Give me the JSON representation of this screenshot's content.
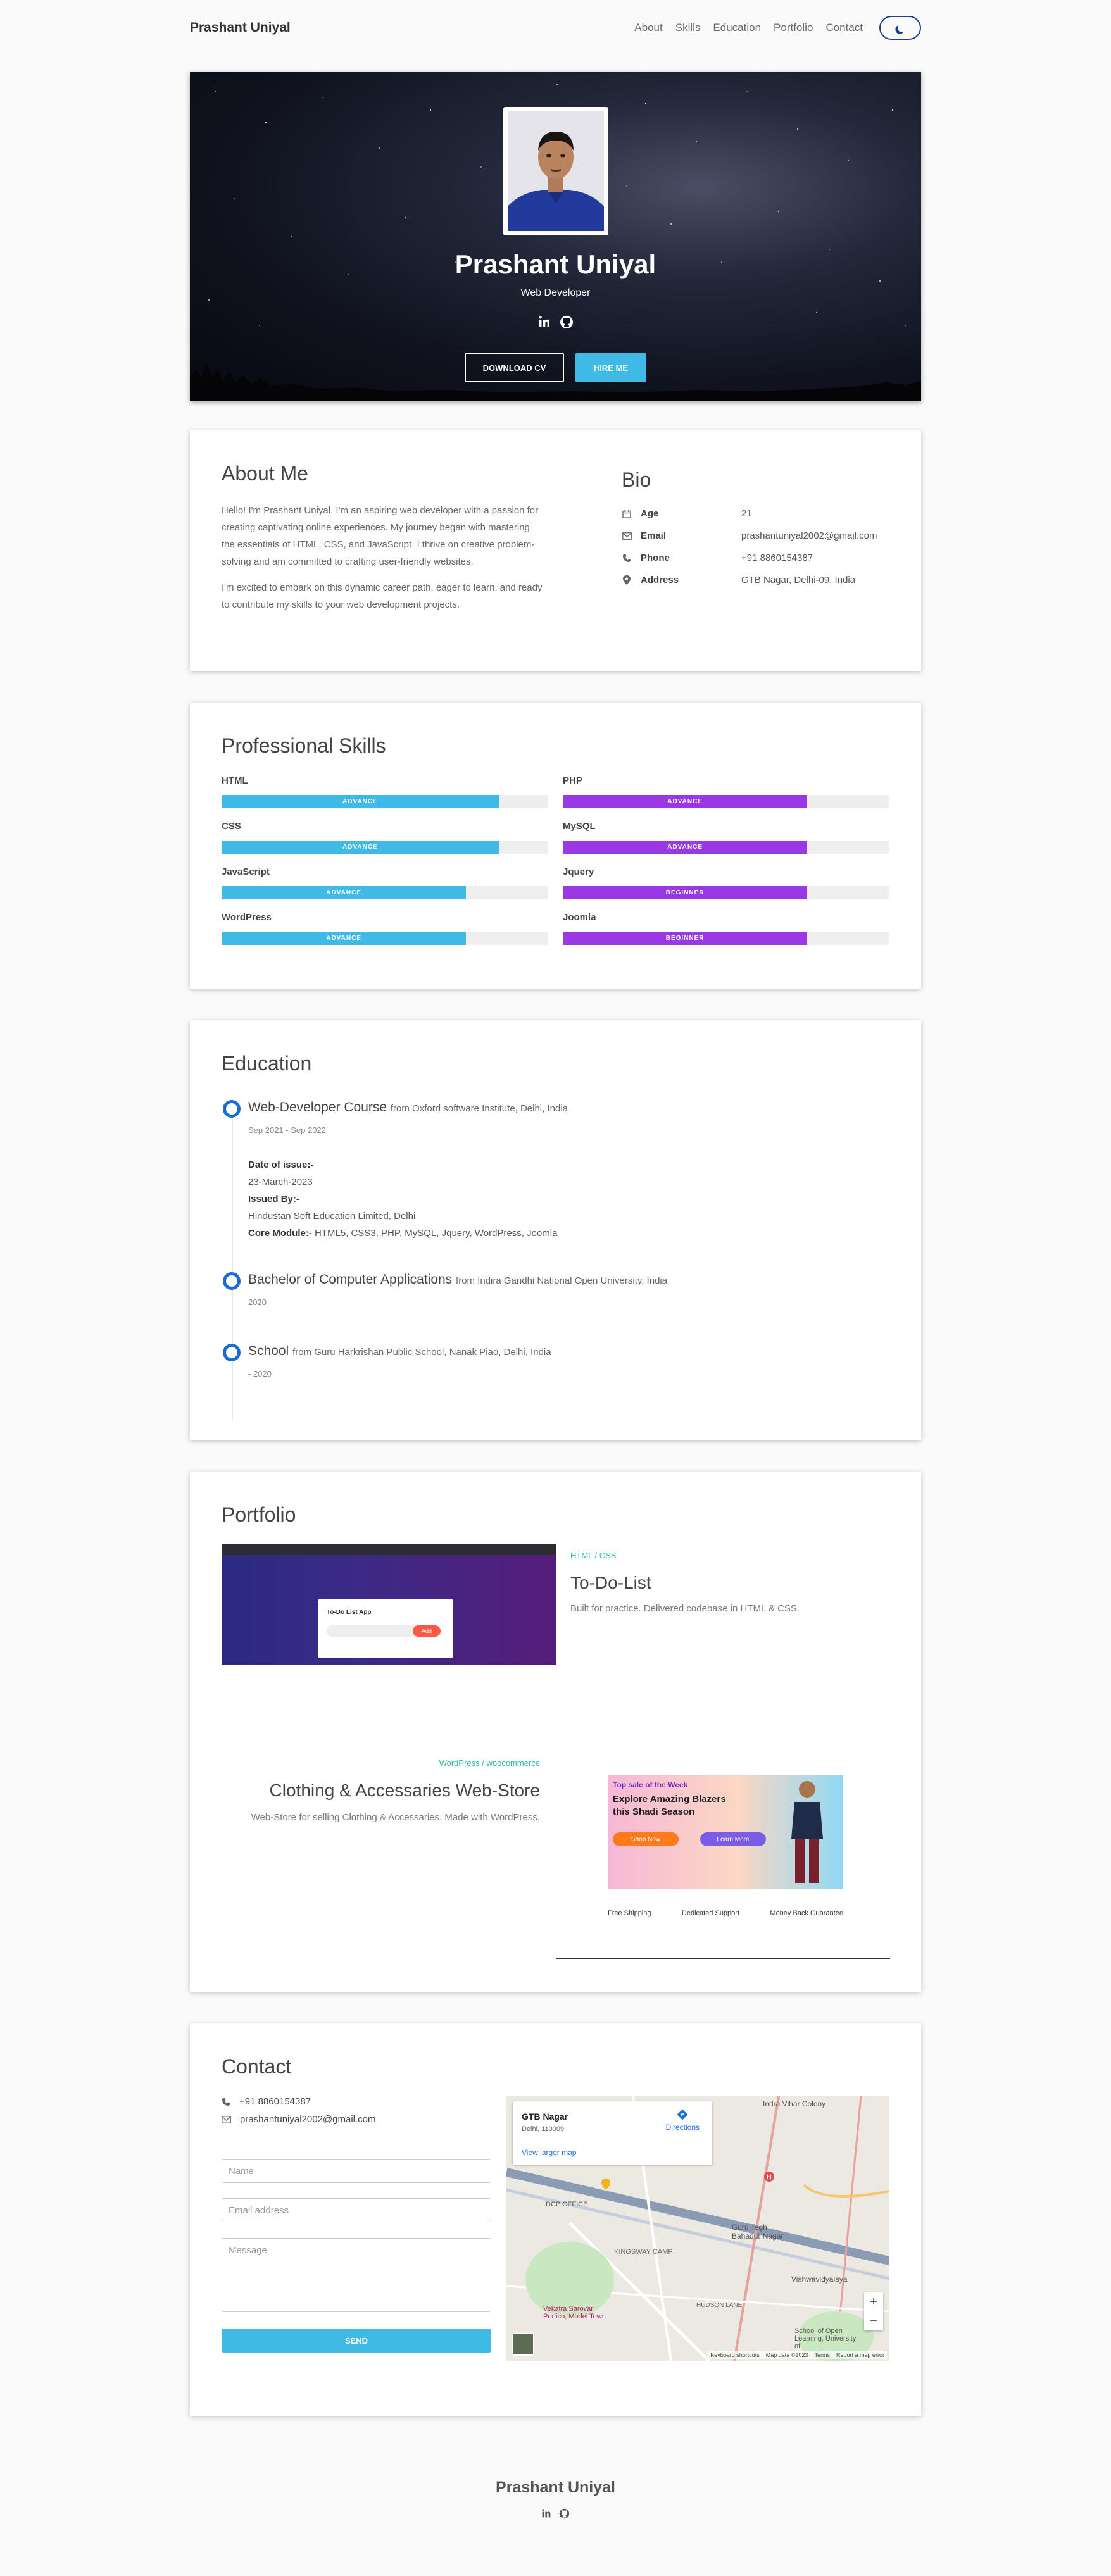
{
  "nav": {
    "brand": "Prashant Uniyal",
    "links": [
      "About",
      "Skills",
      "Education",
      "Portfolio",
      "Contact"
    ]
  },
  "hero": {
    "name": "Prashant Uniyal",
    "role": "Web Developer",
    "download_label": "DOWNLOAD CV",
    "hire_label": "HIRE ME",
    "social_icons": [
      "linkedin-icon",
      "github-icon"
    ]
  },
  "about": {
    "title": "About Me",
    "paragraphs": [
      "Hello! I'm Prashant Uniyal. I'm an aspiring web developer with a passion for creating captivating online experiences. My journey began with mastering the essentials of HTML, CSS, and JavaScript. I thrive on creative problem-solving and am committed to crafting user-friendly websites.",
      "I'm excited to embark on this dynamic career path, eager to learn, and ready to contribute my skills to your web development projects."
    ],
    "bio_title": "Bio",
    "bio": [
      {
        "icon": "calendar-icon",
        "key": "Age",
        "value": "21"
      },
      {
        "icon": "envelope-icon",
        "key": "Email",
        "value": "prashantuniyal2002@gmail.com"
      },
      {
        "icon": "phone-icon",
        "key": "Phone",
        "value": "+91 8860154387"
      },
      {
        "icon": "map-pin-icon",
        "key": "Address",
        "value": "GTB Nagar, Delhi-09, India"
      }
    ]
  },
  "skills": {
    "title": "Professional Skills",
    "left": [
      {
        "name": "HTML",
        "level": "ADVANCE",
        "percent": 85
      },
      {
        "name": "CSS",
        "level": "ADVANCE",
        "percent": 85
      },
      {
        "name": "JavaScript",
        "level": "ADVANCE",
        "percent": 75
      },
      {
        "name": "WordPress",
        "level": "ADVANCE",
        "percent": 75
      }
    ],
    "right": [
      {
        "name": "PHP",
        "level": "ADVANCE",
        "percent": 75
      },
      {
        "name": "MySQL",
        "level": "ADVANCE",
        "percent": 75
      },
      {
        "name": "Jquery",
        "level": "BEGINNER",
        "percent": 75
      },
      {
        "name": "Joomla",
        "level": "BEGINNER",
        "percent": 75
      }
    ],
    "colors": {
      "left": "#3fb9e6",
      "right": "#9b38e6",
      "track": "#eeeeee"
    }
  },
  "education": {
    "title": "Education",
    "items": [
      {
        "title": "Web-Developer Course",
        "from": "from Oxford software Institute, Delhi, India",
        "date": "Sep 2021 - Sep 2022"
      },
      {
        "title": "Bachelor of Computer Applications",
        "from": "from Indira Gandhi National Open University, India",
        "date": "2020 -"
      },
      {
        "title": "School",
        "from": "from Guru Harkrishan Public School, Nanak Piao, Delhi, India",
        "date": "- 2020"
      }
    ],
    "details": {
      "issue_label": "Date of issue:-",
      "issue_value": "23-March-2023",
      "issued_by_label": "Issued By:-",
      "issued_by_value": "Hindustan Soft Education Limited, Delhi",
      "core_label": "Core Module:-",
      "core_value": " HTML5, CSS3, PHP, MySQL, Jquery, WordPress, Joomla"
    }
  },
  "portfolio": {
    "title": "Portfolio",
    "items": [
      {
        "category": "HTML / CSS",
        "title": "To-Do-List",
        "desc": "Built for practice. Delivered codebase in HTML & CSS."
      },
      {
        "category": "WordPress / woocommerce",
        "title": "Clothing & Accessaries Web-Store",
        "desc": "Web-Store for selling Clothing & Accessaries. Made with WordPress."
      }
    ],
    "shot1": {
      "app_title": "To-Do List App",
      "add_label": "Add"
    },
    "shot2": {
      "banner_kicker": "Top sale of the Week",
      "banner_title": "Explore Amazing Blazers this Shadi Season",
      "shop_label": "Shop Now",
      "learn_label": "Learn More",
      "features": [
        "Free Shipping",
        "Dedicated Support",
        "Money Back Guarantee"
      ]
    }
  },
  "contact": {
    "title": "Contact",
    "phone": "+91 8860154387",
    "email": "prashantuniyal2002@gmail.com",
    "name_placeholder": "Name",
    "email_placeholder": "Email address",
    "message_placeholder": "Message",
    "send_label": "SEND",
    "map": {
      "place": "GTB Nagar",
      "place_sub": "Delhi, 110009",
      "directions": "Directions",
      "larger": "View larger map",
      "labels": [
        "Indra Vihar Colony",
        "DCP OFFICE",
        "Guru Tegh Bahadur Nagar",
        "KINGSWAY CAMP",
        "Vishwavidyalaya",
        "HUDSON LANE",
        "Vekatra Sarovar Portico, Model Town",
        "School of Open Learning, University of"
      ],
      "footer": [
        "Keyboard shortcuts",
        "Map data ©2023",
        "Terms",
        "Report a map error"
      ],
      "zoom_in": "+",
      "zoom_out": "−"
    }
  },
  "footer": {
    "name": "Prashant Uniyal"
  }
}
